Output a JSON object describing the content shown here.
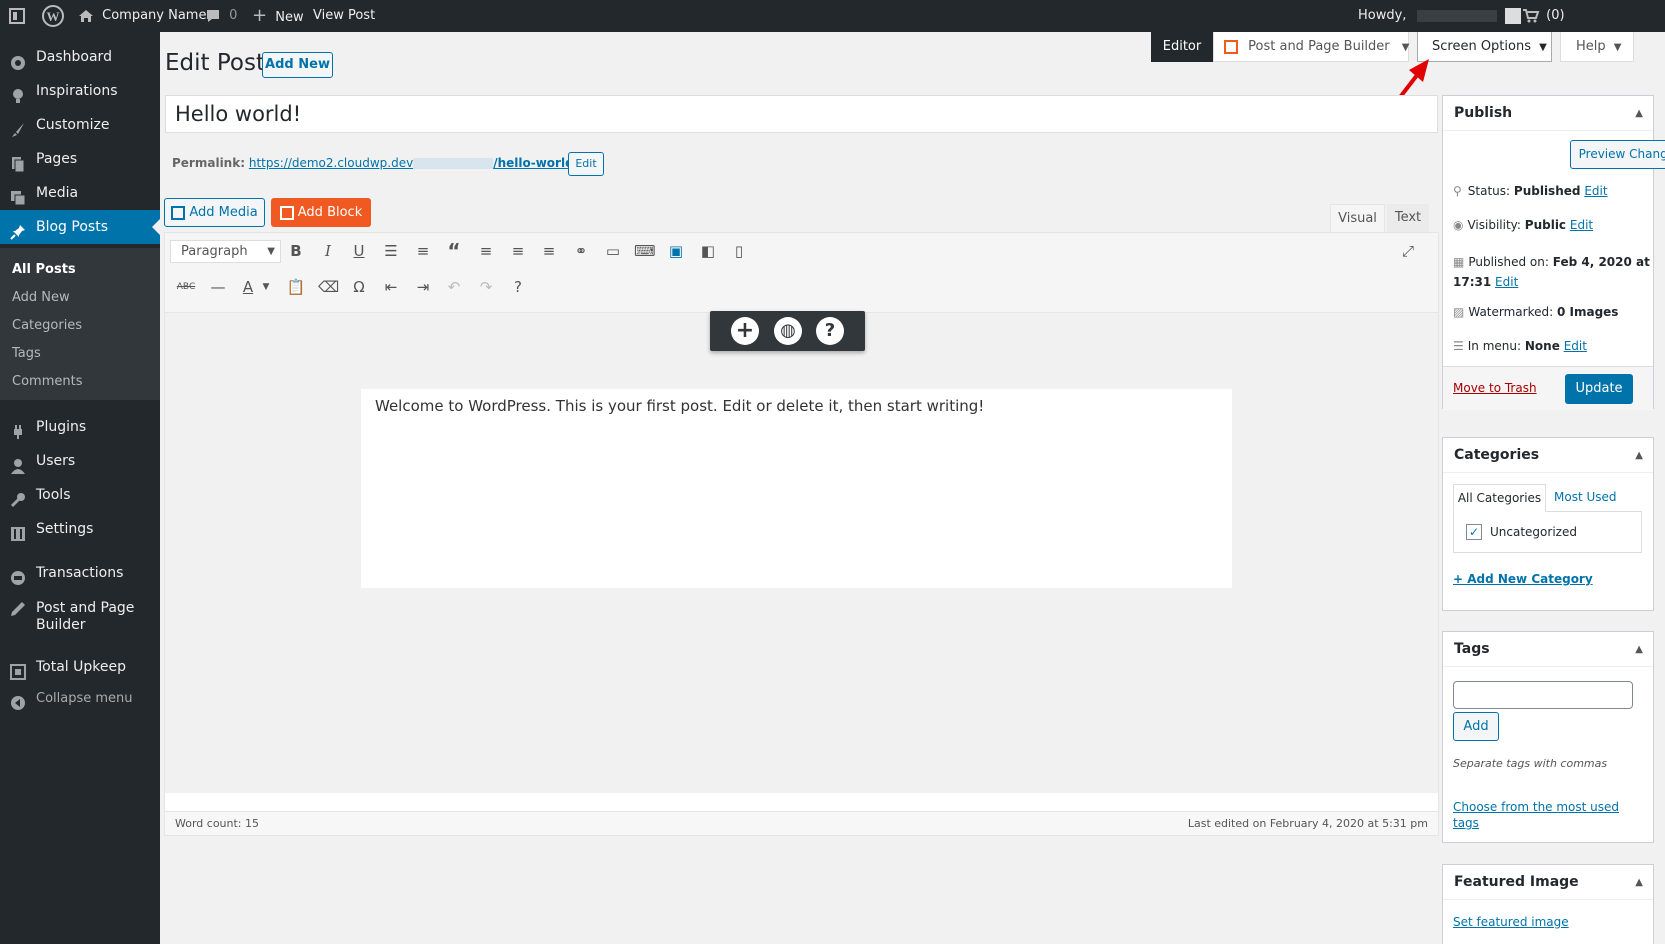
{
  "adminbar": {
    "site_name": "Company Name",
    "comments_count": "0",
    "new_label": "New",
    "view_post": "View Post",
    "howdy": "Howdy,",
    "cart_count": "(0)"
  },
  "sidebar": {
    "items": [
      {
        "label": "Dashboard",
        "icon": "dashboard-icon"
      },
      {
        "label": "Inspirations",
        "icon": "lightbulb-icon"
      },
      {
        "label": "Customize",
        "icon": "brush-icon"
      },
      {
        "label": "Pages",
        "icon": "pages-icon"
      },
      {
        "label": "Media",
        "icon": "media-icon"
      },
      {
        "label": "Blog Posts",
        "icon": "pin-icon"
      },
      {
        "label": "Plugins",
        "icon": "plugin-icon"
      },
      {
        "label": "Users",
        "icon": "users-icon"
      },
      {
        "label": "Tools",
        "icon": "wrench-icon"
      },
      {
        "label": "Settings",
        "icon": "settings-icon"
      },
      {
        "label": "Transactions",
        "icon": "transactions-icon"
      },
      {
        "label": "Post and Page",
        "label2": "Builder",
        "icon": "pencil-icon"
      },
      {
        "label": "Total Upkeep",
        "icon": "upkeep-icon"
      },
      {
        "label": "Collapse menu",
        "icon": "collapse-icon"
      }
    ],
    "submenu": [
      "All Posts",
      "Add New",
      "Categories",
      "Tags",
      "Comments"
    ]
  },
  "top_tabs": {
    "editor": "Editor",
    "builder": "Post and Page Builder",
    "screen_options": "Screen Options",
    "help": "Help"
  },
  "page": {
    "title": "Edit Post",
    "add_new": "Add New",
    "post_title": "Hello world!",
    "permalink_label": "Permalink:",
    "permalink_base": "https://demo2.cloudwp.dev",
    "permalink_slug": "/hello-world/",
    "permalink_edit": "Edit",
    "add_media": "Add Media",
    "add_block": "Add Block",
    "tab_visual": "Visual",
    "tab_text": "Text",
    "format_select": "Paragraph",
    "content": "Welcome to WordPress. This is your first post. Edit or delete it, then start writing!",
    "word_count": "Word count: 15",
    "last_edited": "Last edited on February 4, 2020 at 5:31 pm"
  },
  "publish": {
    "heading": "Publish",
    "preview": "Preview Changes",
    "status_label": "Status:",
    "status_value": "Published",
    "visibility_label": "Visibility:",
    "visibility_value": "Public",
    "published_label": "Published on:",
    "published_value": "Feb 4, 2020 at",
    "published_time": "17:31",
    "watermarked_label": "Watermarked:",
    "watermarked_value": "0 Images",
    "inmenu_label": "In menu:",
    "inmenu_value": "None",
    "edit": "Edit",
    "trash": "Move to Trash",
    "update": "Update"
  },
  "categories": {
    "heading": "Categories",
    "tab_all": "All Categories",
    "tab_used": "Most Used",
    "item": "Uncategorized",
    "add_new": "+ Add New Category"
  },
  "tags": {
    "heading": "Tags",
    "add": "Add",
    "hint": "Separate tags with commas",
    "choose": "Choose from the most used",
    "choose2": "tags"
  },
  "featured": {
    "heading": "Featured Image",
    "set": "Set featured image"
  },
  "colors": {
    "accent": "#0073aa",
    "admin_dark": "#23282d",
    "add_block": "#f05a22",
    "trash": "#a00",
    "arrow": "#e00000"
  }
}
